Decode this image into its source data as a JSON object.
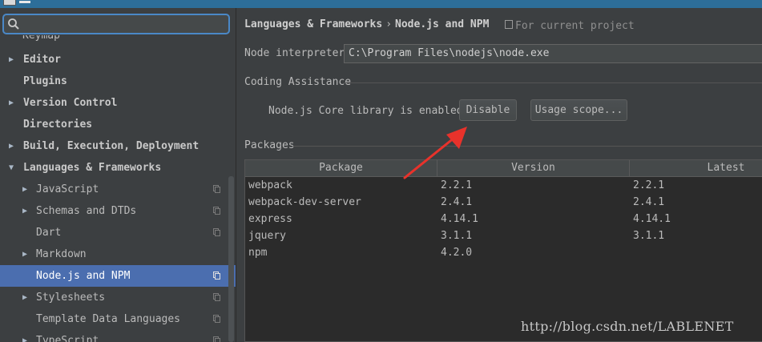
{
  "search": {
    "placeholder": "",
    "value": ""
  },
  "sidebar": {
    "clipped_text": "Keymap",
    "items": [
      {
        "label": "Editor",
        "arrow": "▶",
        "bold": true
      },
      {
        "label": "Plugins",
        "arrow": "",
        "bold": true
      },
      {
        "label": "Version Control",
        "arrow": "▶",
        "bold": true
      },
      {
        "label": "Directories",
        "arrow": "",
        "bold": true
      },
      {
        "label": "Build, Execution, Deployment",
        "arrow": "▶",
        "bold": true
      },
      {
        "label": "Languages & Frameworks",
        "arrow": "▼",
        "bold": true
      },
      {
        "label": "JavaScript",
        "arrow": "▶",
        "bold": false
      },
      {
        "label": "Schemas and DTDs",
        "arrow": "▶",
        "bold": false
      },
      {
        "label": "Dart",
        "arrow": "",
        "bold": false
      },
      {
        "label": "Markdown",
        "arrow": "▶",
        "bold": false
      },
      {
        "label": "Node.js and NPM",
        "arrow": "",
        "bold": false,
        "selected": true
      },
      {
        "label": "Stylesheets",
        "arrow": "▶",
        "bold": false
      },
      {
        "label": "Template Data Languages",
        "arrow": "",
        "bold": false
      },
      {
        "label": "TypeScript",
        "arrow": "▶",
        "bold": false
      }
    ]
  },
  "header": {
    "crumb_parent": "Languages & Frameworks",
    "crumb_sep": "›",
    "crumb_current": "Node.js and NPM",
    "scope": "For current project"
  },
  "interpreter": {
    "label": "Node interpreter:",
    "value": "C:\\Program Files\\nodejs\\node.exe"
  },
  "coding_assistance": {
    "title": "Coding Assistance",
    "status": "Node.js Core library is enabled.",
    "disable_label": "Disable",
    "usage_scope_label": "Usage scope..."
  },
  "packages": {
    "title": "Packages",
    "columns": [
      "Package",
      "Version",
      "Latest"
    ],
    "rows": [
      {
        "package": "webpack",
        "version": "2.2.1",
        "latest": "2.2.1"
      },
      {
        "package": "webpack-dev-server",
        "version": "2.4.1",
        "latest": "2.4.1"
      },
      {
        "package": "express",
        "version": "4.14.1",
        "latest": "4.14.1"
      },
      {
        "package": "jquery",
        "version": "3.1.1",
        "latest": "3.1.1"
      },
      {
        "package": "npm",
        "version": "4.2.0",
        "latest": ""
      }
    ]
  },
  "watermark": "http://blog.csdn.net/LABLENET",
  "colors": {
    "selection": "#4b6eaf",
    "background": "#3c3f41",
    "table_bg": "#2b2b2b",
    "annotation_arrow": "#e8322b",
    "titlebar": "#2d6e99"
  }
}
